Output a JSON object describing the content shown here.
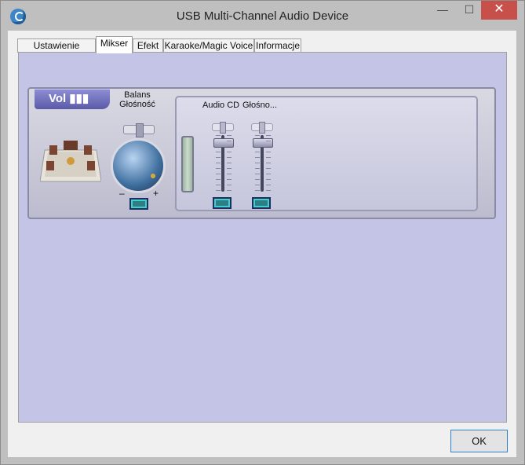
{
  "window": {
    "title": "USB Multi-Channel Audio Device",
    "minimize": "—",
    "maximize": "☐",
    "close": "✕"
  },
  "tabs": [
    {
      "label": "Ustawienie główne"
    },
    {
      "label": "Mikser"
    },
    {
      "label": "Efekt"
    },
    {
      "label": "Karaoke/Magic Voice"
    },
    {
      "label": "Informacje"
    }
  ],
  "active_tab": "Mikser",
  "mixer": {
    "badge": "Vol",
    "balance_label": "Balans",
    "volume_label": "Głośność",
    "minus": "–",
    "plus": "+",
    "channel_label": "Audio CD",
    "channel_volume_label": "Głośno..."
  },
  "footer": {
    "ok_label": "OK"
  },
  "colors": {
    "panel_bg": "#c4c4e6",
    "close_red": "#c7504b",
    "ok_border": "#2f80d0"
  }
}
